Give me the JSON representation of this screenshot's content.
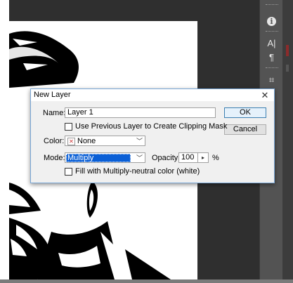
{
  "dialog": {
    "title": "New Layer",
    "close_glyph": "✕",
    "name_label": "Name:",
    "name_value": "Layer 1",
    "clipping_mask_label": "Use Previous Layer to Create Clipping Mask",
    "clipping_mask_checked": false,
    "color_label": "Color:",
    "color_value": "None",
    "mode_label": "Mode:",
    "mode_value": "Multiply",
    "opacity_label": "Opacity:",
    "opacity_value": "100",
    "opacity_unit": "%",
    "fill_neutral_label": "Fill with Multiply-neutral color (white)",
    "fill_neutral_checked": false,
    "ok_label": "OK",
    "cancel_label": "Cancel"
  },
  "panel": {
    "icons": [
      "info-icon",
      "character-icon",
      "paragraph-icon",
      "glyphs-icon"
    ],
    "character_glyph": "A|",
    "paragraph_glyph": "¶",
    "glyphs_glyph": "⌗",
    "info_glyph": "i"
  },
  "colors": {
    "workspace": "#2f2f2f",
    "panel": "#535353",
    "dialog_bg": "#f0f0f0",
    "selection": "#0a5fd6",
    "ok_border": "#3c7fb1"
  }
}
